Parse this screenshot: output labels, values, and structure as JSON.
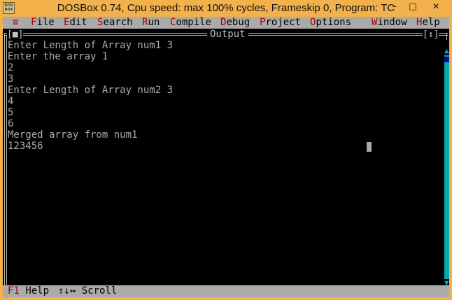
{
  "window": {
    "title": "DOSBox 0.74, Cpu speed: max 100% cycles, Frameskip  0, Program:    TC",
    "icon_text": "DOS BOX",
    "buttons": {
      "minimize": "–",
      "maximize": "□",
      "close": "✕"
    }
  },
  "menu": {
    "system": "≡",
    "items": [
      {
        "hotkey": "F",
        "rest": "ile"
      },
      {
        "hotkey": "E",
        "rest": "dit"
      },
      {
        "hotkey": "S",
        "rest": "earch"
      },
      {
        "hotkey": "R",
        "rest": "un"
      },
      {
        "hotkey": "C",
        "rest": "ompile"
      },
      {
        "hotkey": "D",
        "rest": "ebug"
      },
      {
        "hotkey": "P",
        "rest": "roject"
      },
      {
        "hotkey": "O",
        "rest": "ptions"
      },
      {
        "hotkey": "W",
        "rest": "indow"
      },
      {
        "hotkey": "H",
        "rest": "elp"
      }
    ]
  },
  "output_window": {
    "title": "Output",
    "close_box": "[■]",
    "zoom_box": "[↕]",
    "lines": [
      "Enter Length of Array num1 3",
      "Enter the array 1",
      "2",
      "3",
      "Enter Length of Array num2 3",
      "4",
      "5",
      "6",
      "Merged array from num1",
      "123456"
    ]
  },
  "scrollbars": {
    "up": "▲",
    "down": "▼",
    "left": "◄",
    "right": "►"
  },
  "status": {
    "help_key": "F1",
    "help_label": " Help",
    "scroll_label": "↑↓↔ Scroll"
  }
}
